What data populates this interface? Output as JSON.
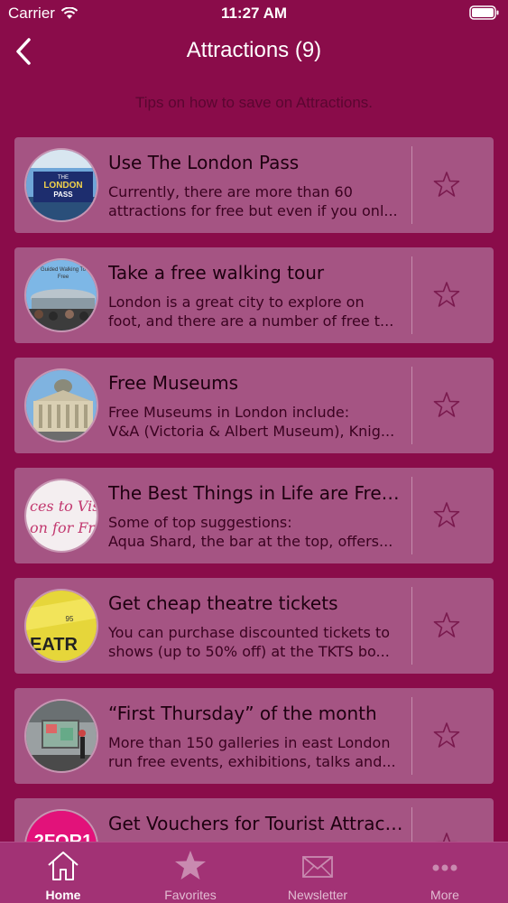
{
  "status_bar": {
    "carrier": "Carrier",
    "time": "11:27 AM"
  },
  "nav": {
    "title": "Attractions (9)"
  },
  "subtitle": "Tips on how to save on Attractions.",
  "items": [
    {
      "title": "Use The London Pass",
      "desc1": "Currently, there are more than 60",
      "desc2": "attractions for free but even if you onl...",
      "thumb_text1": "THE",
      "thumb_text2": "LONDON",
      "thumb_text3": "PASS"
    },
    {
      "title": "Take a free walking tour",
      "desc1": "London is a great city to explore on",
      "desc2": "foot, and there are a number of free t...",
      "thumb_text1": "Guided Walking To",
      "thumb_text2": "Free"
    },
    {
      "title": "Free Museums",
      "desc1": "Free Museums in London include:",
      "desc2": "V&A (Victoria & Albert Museum), Knig..."
    },
    {
      "title": "The Best Things in Life are Free (...",
      "desc1": "Some of top suggestions:",
      "desc2": "Aqua Shard, the bar at the top, offers...",
      "thumb_text1": "ces to Vis",
      "thumb_text2": "on for Fr"
    },
    {
      "title": "Get cheap theatre tickets",
      "desc1": "You can purchase discounted tickets to",
      "desc2": "shows (up to 50% off) at the TKTS bo...",
      "thumb_text1": "EATR",
      "thumb_text2": "95"
    },
    {
      "title": "“First Thursday” of the month",
      "desc1": "More than 150 galleries in east London",
      "desc2": "run free events, exhibitions, talks and..."
    },
    {
      "title": "Get Vouchers for Tourist Attracti...",
      "desc1": "",
      "desc2": "",
      "thumb_text1": "2FOR1"
    }
  ],
  "tabs": [
    {
      "label": "Home",
      "icon": "home-icon"
    },
    {
      "label": "Favorites",
      "icon": "star-icon"
    },
    {
      "label": "Newsletter",
      "icon": "envelope-icon"
    },
    {
      "label": "More",
      "icon": "more-icon"
    }
  ],
  "colors": {
    "background": "#8a0c4a",
    "card": "#a55483",
    "tab_bar": "#a23275"
  }
}
